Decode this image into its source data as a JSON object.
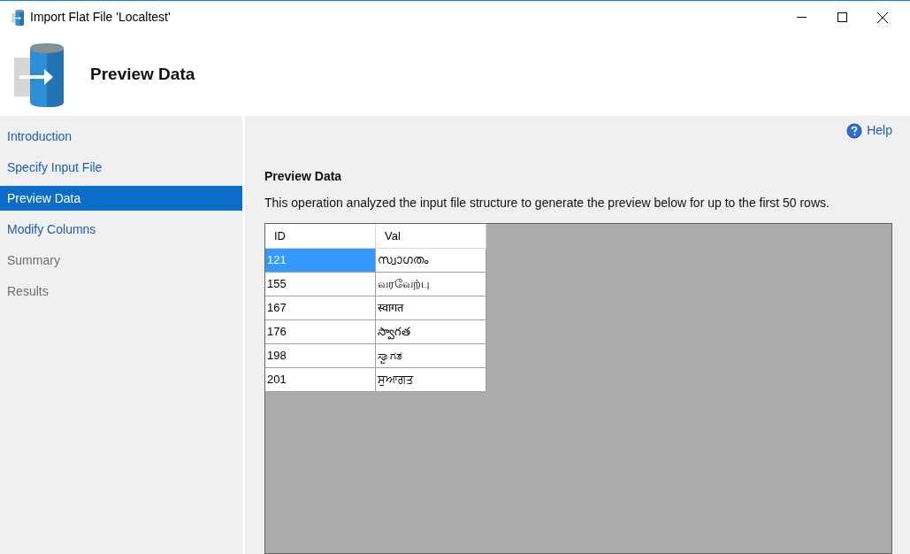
{
  "window": {
    "title": "Import Flat File 'Localtest'"
  },
  "header": {
    "title": "Preview Data"
  },
  "sidebar": {
    "items": [
      {
        "label": "Introduction",
        "selected": false,
        "disabled": false
      },
      {
        "label": "Specify Input File",
        "selected": false,
        "disabled": false
      },
      {
        "label": "Preview Data",
        "selected": true,
        "disabled": false
      },
      {
        "label": "Modify Columns",
        "selected": false,
        "disabled": false
      },
      {
        "label": "Summary",
        "selected": false,
        "disabled": true
      },
      {
        "label": "Results",
        "selected": false,
        "disabled": true
      }
    ]
  },
  "help": {
    "label": "Help"
  },
  "section": {
    "title": "Preview Data",
    "description": "This operation analyzed the input file structure to generate the preview below for up to the first 50 rows."
  },
  "table": {
    "columns": [
      "ID",
      "Val"
    ],
    "rows": [
      {
        "cells": [
          "121",
          "സ്വാഗതം"
        ],
        "selected": true
      },
      {
        "cells": [
          "155",
          "வரவேற்பு"
        ],
        "selected": false
      },
      {
        "cells": [
          "167",
          "स्वागत"
        ],
        "selected": false
      },
      {
        "cells": [
          "176",
          "స్వాగత"
        ],
        "selected": false
      },
      {
        "cells": [
          "198",
          "ಸ್ವಾಗತ"
        ],
        "selected": false
      },
      {
        "cells": [
          "201",
          "ਸੁਆਗਤ"
        ],
        "selected": false
      }
    ]
  }
}
